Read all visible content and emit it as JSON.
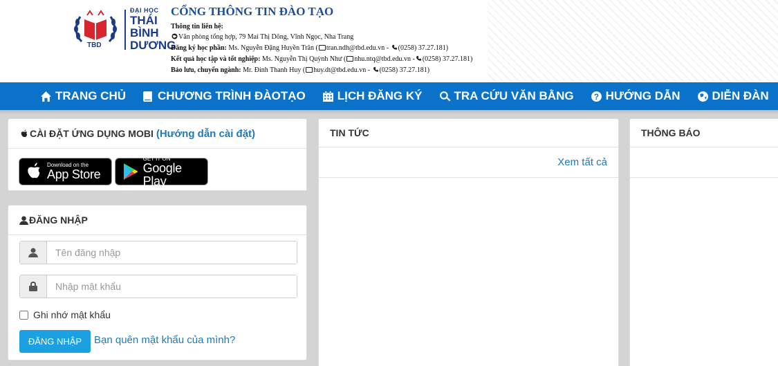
{
  "header": {
    "logo": {
      "small_text": "ĐẠI HỌC",
      "line1": "THÁI",
      "line2": "BÌNH",
      "line3": "DƯƠNG",
      "abbr": "TBD"
    },
    "portal_title": "CỔNG THÔNG TIN ĐÀO TẠO",
    "contact": {
      "heading": "Thông tin liên hệ:",
      "address": "Văn phòng tổng hợp, 79 Mai Thị Dõng, Vĩnh Ngọc, Nha Trang",
      "registration_label": "Đăng ký học phần:",
      "registration_person": "Ms. Nguyễn Đặng Huyền Trân (",
      "registration_email": "tran.ndh@tbd.edu.vn -",
      "registration_phone": "(0258) 37.27.181)",
      "results_label": "Kết quả học tập và tốt nghiệp:",
      "results_person": "Ms. Nguyễn Thị Quỳnh Như (",
      "results_email": "nhu.ntq@tbd.edu.vn -",
      "results_phone": "(0258) 37.27.181)",
      "archive_label": "Bảo lưu, chuyển ngành:",
      "archive_person": "Mr. Đinh Thanh Huy (",
      "archive_email": "huy.dt@tbd.edu.vn -",
      "archive_phone": "(0258) 37.27.181)"
    }
  },
  "nav": {
    "items": [
      {
        "label": "TRANG CHỦ",
        "icon": "home-icon"
      },
      {
        "label": "CHƯƠNG TRÌNH ĐÀOTẠO",
        "icon": "book-icon"
      },
      {
        "label": "LỊCH ĐĂNG KÝ",
        "icon": "calendar-icon"
      },
      {
        "label": "TRA CỨU VĂN BẰNG",
        "icon": "search-icon"
      },
      {
        "label": "HƯỚNG DẪN",
        "icon": "question-icon"
      },
      {
        "label": "DIỄN ĐÀN",
        "icon": "globe-icon"
      }
    ],
    "color": "#0a73c9"
  },
  "apps_panel": {
    "title": "CÀI ĐẶT ỨNG DỤNG MOBI",
    "guide_link": "(Hướng dẫn cài đặt)",
    "app_store": {
      "small": "Download on the",
      "big": "App Store"
    },
    "google_play": {
      "small": "GET IT ON",
      "big": "Google Play"
    }
  },
  "login_panel": {
    "title": "ĐĂNG NHẬP",
    "username_placeholder": "Tên đăng nhập",
    "password_placeholder": "Nhập mật khẩu",
    "remember_label": "Ghi nhớ mật khẩu",
    "login_button": "ĐĂNG NHẬP",
    "forgot_link": "Bạn quên mật khẩu của mình?",
    "button_color": "#1ba1e2"
  },
  "news_panel": {
    "title": "TIN TỨC",
    "see_all": "Xem tất cả"
  },
  "notice_panel": {
    "title": "THÔNG BÁO"
  }
}
